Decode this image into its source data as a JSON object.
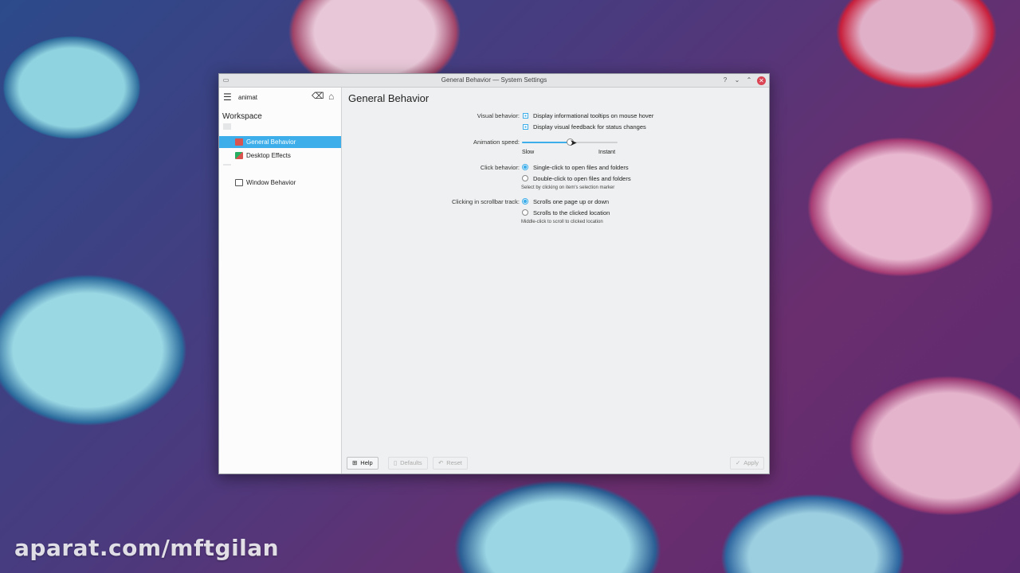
{
  "window": {
    "title": "General Behavior — System Settings"
  },
  "titlebar": {
    "buttons": [
      "?",
      "⌄",
      "⌃",
      "✕"
    ]
  },
  "sidebar": {
    "search_value": "animat",
    "category": "Workspace",
    "items": [
      {
        "label": "General Behavior",
        "active": true,
        "icon_color": "#d9534f"
      },
      {
        "label": "Desktop Effects",
        "active": false,
        "icon_color": "#27ae60"
      },
      {
        "label": "Window Behavior",
        "active": false,
        "icon_color": "#555555"
      }
    ]
  },
  "main": {
    "title": "General Behavior",
    "visual_behavior": {
      "label": "Visual behavior:",
      "options": [
        {
          "label": "Display informational tooltips on mouse hover",
          "checked": true
        },
        {
          "label": "Display visual feedback for status changes",
          "checked": true
        }
      ]
    },
    "animation_speed": {
      "label": "Animation speed:",
      "min_label": "Slow",
      "max_label": "Instant",
      "value": 0.5
    },
    "click_behavior": {
      "label": "Click behavior:",
      "options": [
        {
          "label": "Single-click to open files and folders",
          "selected": true
        },
        {
          "label": "Double-click to open files and folders",
          "selected": false
        }
      ],
      "hint": "Select by clicking on item's selection marker"
    },
    "scrollbar_track": {
      "label": "Clicking in scrollbar track:",
      "options": [
        {
          "label": "Scrolls one page up or down",
          "selected": true
        },
        {
          "label": "Scrolls to the clicked location",
          "selected": false
        }
      ],
      "hint": "Middle-click to scroll to clicked location"
    }
  },
  "footer": {
    "help": "Help",
    "defaults": "Defaults",
    "reset": "Reset",
    "apply": "Apply"
  },
  "watermark": "aparat.com/mftgilan",
  "colors": {
    "accent": "#3daee9",
    "close": "#da4453"
  }
}
